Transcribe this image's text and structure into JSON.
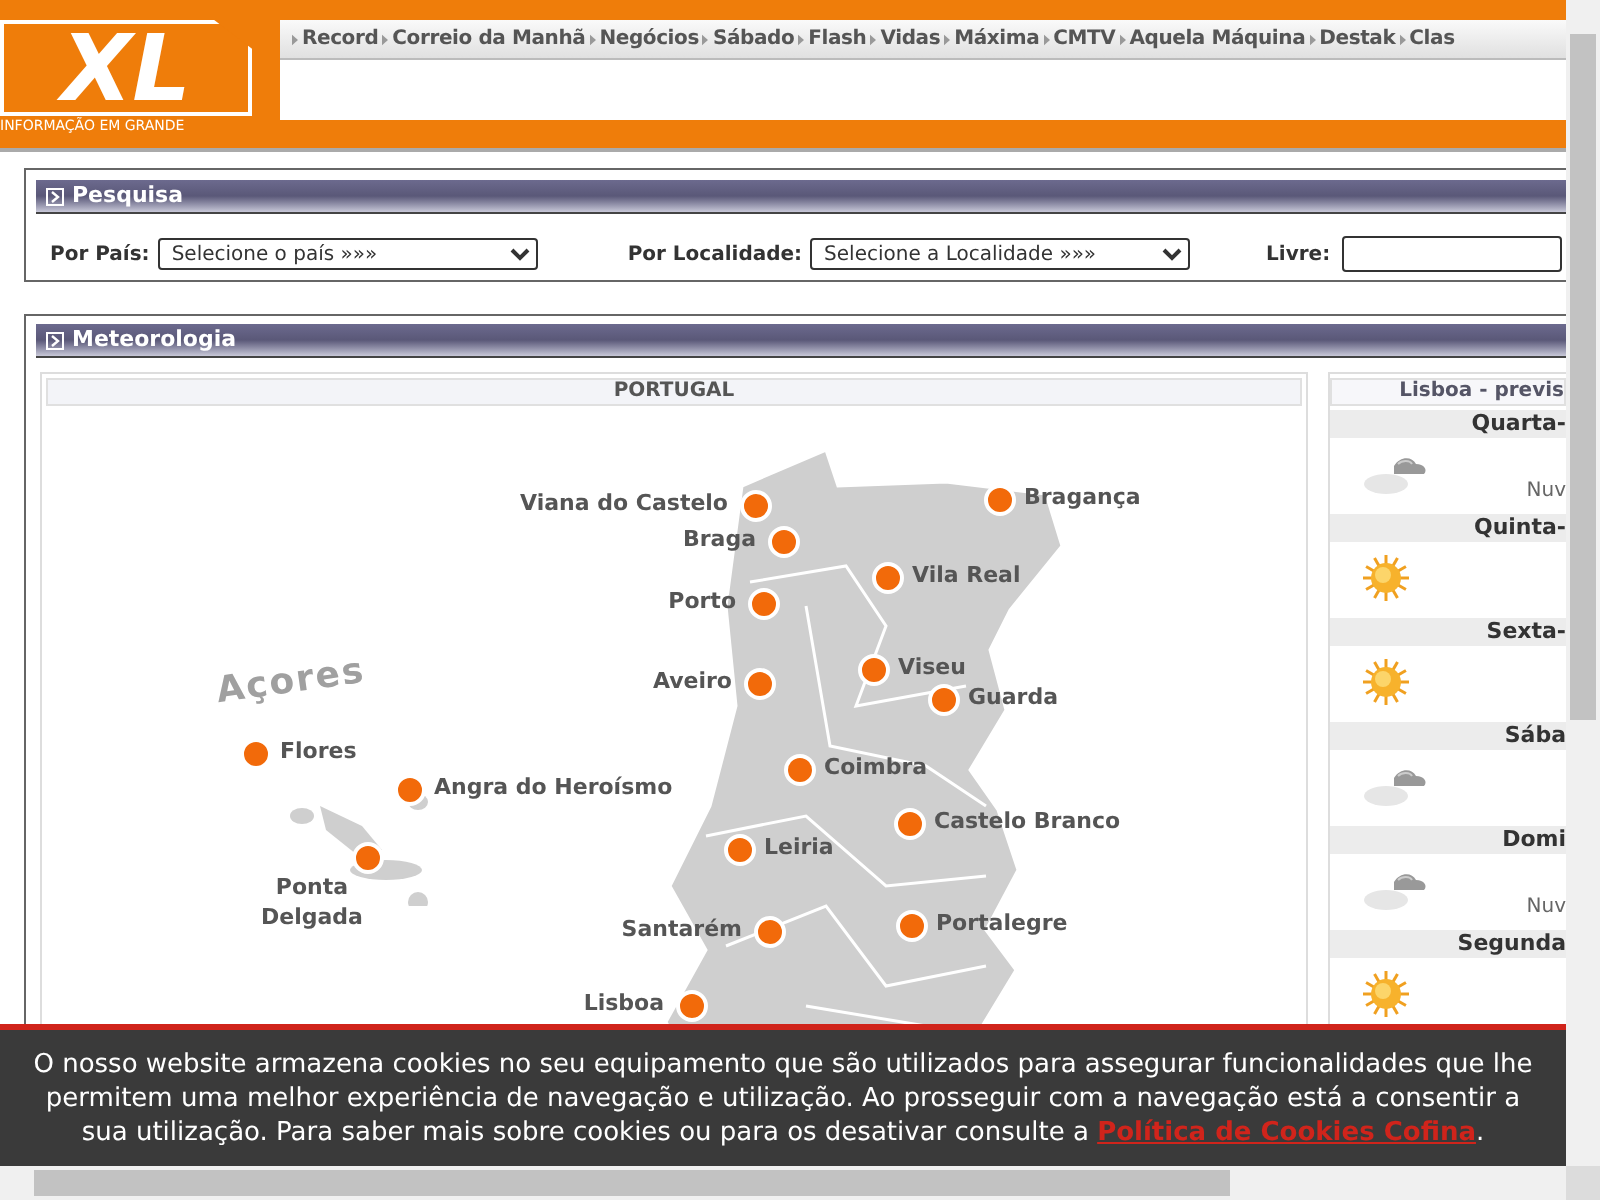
{
  "header": {
    "logo": {
      "mark": "XL",
      "tagline": "INFORMAÇÃO EM GRANDE"
    },
    "nav": [
      "Record",
      "Correio da Manhã",
      "Negócios",
      "Sábado",
      "Flash",
      "Vidas",
      "Máxima",
      "CMTV",
      "Aquela Máquina",
      "Destak",
      "Clas"
    ]
  },
  "search": {
    "title": "Pesquisa",
    "country_label": "Por País:",
    "country_value": "Selecione o país »»»",
    "locality_label": "Por Localidade:",
    "locality_value": "Selecione a Localidade »»»",
    "free_label": "Livre:"
  },
  "weather": {
    "title": "Meteorologia",
    "map_title": "PORTUGAL",
    "azores_label": "Açores",
    "cities": [
      {
        "name": "Viana do Castelo"
      },
      {
        "name": "Braga"
      },
      {
        "name": "Porto"
      },
      {
        "name": "Aveiro"
      },
      {
        "name": "Bragança"
      },
      {
        "name": "Vila Real"
      },
      {
        "name": "Viseu"
      },
      {
        "name": "Guarda"
      },
      {
        "name": "Coimbra"
      },
      {
        "name": "Castelo Branco"
      },
      {
        "name": "Leiria"
      },
      {
        "name": "Santarém"
      },
      {
        "name": "Portalegre"
      },
      {
        "name": "Lisboa"
      },
      {
        "name": "Flores"
      },
      {
        "name": "Angra do Heroísmo"
      },
      {
        "name": "Ponta Delgada"
      }
    ],
    "forecast_title": "Lisboa - previs",
    "days": [
      {
        "day": "Quarta-",
        "kind": "cloudy",
        "description": "Nuv"
      },
      {
        "day": "Quinta-",
        "kind": "sunny"
      },
      {
        "day": "Sexta-",
        "kind": "sunny"
      },
      {
        "day": "Sába",
        "kind": "cloudy"
      },
      {
        "day": "Domi",
        "kind": "cloudy",
        "description": "Nuv"
      },
      {
        "day": "Segunda",
        "kind": "sunny"
      }
    ]
  },
  "cookie_banner": {
    "text": "O nosso website armazena cookies no seu equipamento que são utilizados para assegurar funcionalidades que lhe permitem uma melhor experiência de navegação e utilização. Ao prosseguir com a navegação está a consentir a sua utilização. Para saber mais sobre cookies ou para os desativar consulte a",
    "link": "Política de Cookies Cofina",
    "end": "."
  }
}
